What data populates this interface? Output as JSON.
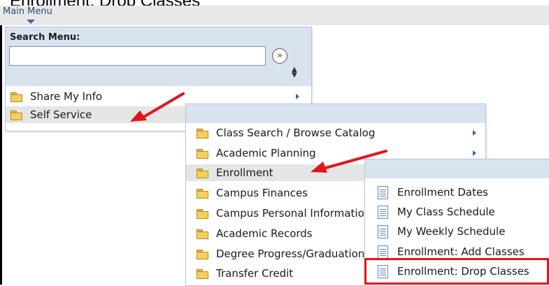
{
  "caption": "Enrollment: Drop Classes",
  "main_menu_label": "Main Menu",
  "search": {
    "label": "Search Menu:",
    "value": "",
    "placeholder": "",
    "go_symbol": "»",
    "sort_symbol": "▲\n▼"
  },
  "level1": {
    "items": [
      {
        "label": "Share My Info",
        "icon": "folder-icon",
        "has_submenu": true
      },
      {
        "label": "Self Service",
        "icon": "folder-icon",
        "has_submenu": false
      }
    ]
  },
  "level2": {
    "items": [
      {
        "label": "Class Search / Browse Catalog",
        "icon": "folder-icon",
        "has_submenu": true
      },
      {
        "label": "Academic Planning",
        "icon": "folder-icon",
        "has_submenu": true
      },
      {
        "label": "Enrollment",
        "icon": "folder-icon",
        "has_submenu": false
      },
      {
        "label": "Campus Finances",
        "icon": "folder-icon",
        "has_submenu": false
      },
      {
        "label": "Campus Personal Information",
        "icon": "folder-icon",
        "has_submenu": false
      },
      {
        "label": "Academic Records",
        "icon": "folder-icon",
        "has_submenu": false
      },
      {
        "label": "Degree Progress/Graduation",
        "icon": "folder-icon",
        "has_submenu": false
      },
      {
        "label": "Transfer Credit",
        "icon": "folder-icon",
        "has_submenu": false
      }
    ]
  },
  "level3": {
    "items": [
      {
        "label": "Enrollment Dates",
        "icon": "document-icon"
      },
      {
        "label": "My Class Schedule",
        "icon": "document-icon"
      },
      {
        "label": "My Weekly Schedule",
        "icon": "document-icon"
      },
      {
        "label": "Enrollment: Add Classes",
        "icon": "document-icon"
      },
      {
        "label": "Enrollment: Drop Classes",
        "icon": "document-icon"
      }
    ]
  },
  "colors": {
    "panel": "#d9e3ef",
    "highlight_row": "#e4e6e6",
    "annotation_red": "#e4141b",
    "submenu_arrow": "#2f68b5"
  }
}
